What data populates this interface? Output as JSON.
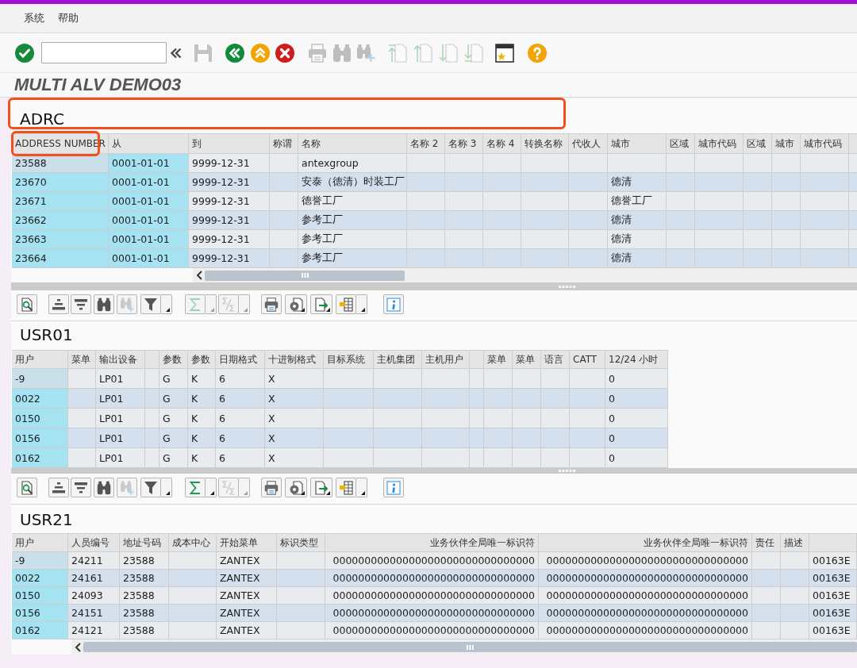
{
  "menu": [
    "系统",
    "帮助"
  ],
  "toolbar": [
    {
      "kind": "enter",
      "disabled": false
    },
    {
      "kind": "command-field"
    },
    {
      "kind": "collapse",
      "disabled": false
    },
    {
      "kind": "save",
      "disabled": true
    },
    {
      "kind": "back",
      "disabled": false
    },
    {
      "kind": "exit",
      "disabled": false
    },
    {
      "kind": "cancel",
      "disabled": false
    },
    {
      "kind": "print",
      "disabled": true
    },
    {
      "kind": "find",
      "disabled": true
    },
    {
      "kind": "find-next",
      "disabled": true
    },
    {
      "kind": "first-page",
      "disabled": true
    },
    {
      "kind": "previous-page",
      "disabled": true
    },
    {
      "kind": "next-page",
      "disabled": true
    },
    {
      "kind": "last-page",
      "disabled": true
    },
    {
      "kind": "new-session",
      "disabled": false
    },
    {
      "kind": "help",
      "disabled": false
    }
  ],
  "title": "MULTI ALV DEMO03",
  "grids": [
    {
      "title": "ADRC",
      "title_highlighted": true,
      "columns": [
        {
          "label": "ADDRESS NUMBER",
          "key": true,
          "highlighted": true
        },
        {
          "label": "从",
          "key": true,
          "highlighted": false
        },
        {
          "label": "到",
          "key": false,
          "highlighted": false
        },
        {
          "label": "称谓",
          "key": false,
          "highlighted": false
        },
        {
          "label": "名称",
          "key": false,
          "highlighted": false
        },
        {
          "label": "名称 2",
          "key": false,
          "highlighted": false
        },
        {
          "label": "名称 3",
          "key": false,
          "highlighted": false
        },
        {
          "label": "名称 4",
          "key": false,
          "highlighted": false
        },
        {
          "label": "转换名称",
          "key": false,
          "highlighted": false
        },
        {
          "label": "代收人",
          "key": false,
          "highlighted": false
        },
        {
          "label": "城市",
          "key": false,
          "highlighted": false
        },
        {
          "label": "区域",
          "key": false,
          "highlighted": false
        },
        {
          "label": "城市代码",
          "key": false,
          "highlighted": false
        },
        {
          "label": "区域",
          "key": false,
          "highlighted": false
        },
        {
          "label": "城市",
          "key": false,
          "highlighted": false
        },
        {
          "label": "城市代码",
          "key": false,
          "highlighted": false
        }
      ],
      "rows": [
        {
          "focused": true,
          "cells": [
            "23588",
            "0001-01-01",
            "9999-12-31",
            null,
            "antexgroup",
            null,
            null,
            null,
            null,
            null,
            null,
            null,
            null,
            null,
            null,
            null
          ]
        },
        {
          "focused": false,
          "cells": [
            "23670",
            "0001-01-01",
            "9999-12-31",
            null,
            "安泰（德清）时装工厂",
            null,
            null,
            null,
            null,
            null,
            "德清",
            null,
            null,
            null,
            null,
            null
          ]
        },
        {
          "focused": false,
          "cells": [
            "23671",
            "0001-01-01",
            "9999-12-31",
            null,
            "德誉工厂",
            null,
            null,
            null,
            null,
            null,
            "德誉工厂",
            null,
            null,
            null,
            null,
            null
          ]
        },
        {
          "focused": false,
          "cells": [
            "23662",
            "0001-01-01",
            "9999-12-31",
            null,
            "参考工厂",
            null,
            null,
            null,
            null,
            null,
            "德清",
            null,
            null,
            null,
            null,
            null
          ]
        },
        {
          "focused": false,
          "cells": [
            "23663",
            "0001-01-01",
            "9999-12-31",
            null,
            "参考工厂",
            null,
            null,
            null,
            null,
            null,
            "德清",
            null,
            null,
            null,
            null,
            null
          ]
        },
        {
          "focused": false,
          "cells": [
            "23664",
            "0001-01-01",
            "9999-12-31",
            null,
            "参考工厂",
            null,
            null,
            null,
            null,
            null,
            "德清",
            null,
            null,
            null,
            null,
            null
          ]
        }
      ]
    },
    {
      "title": "USR01",
      "title_highlighted": false,
      "toolbar": [
        {
          "kind": "details",
          "disabled": false,
          "split_menu": false,
          "inline_menu": false
        },
        {
          "kind": "sort-asc",
          "disabled": false,
          "split_menu": false,
          "inline_menu": false
        },
        {
          "kind": "sort-desc",
          "disabled": false,
          "split_menu": false,
          "inline_menu": false
        },
        {
          "kind": "find",
          "disabled": false,
          "split_menu": false,
          "inline_menu": false
        },
        {
          "kind": "find-next",
          "disabled": true,
          "split_menu": false,
          "inline_menu": false
        },
        {
          "kind": "filter",
          "disabled": false,
          "split_menu": true,
          "inline_menu": false
        },
        {
          "kind": "sum",
          "disabled": true,
          "split_menu": true,
          "inline_menu": false
        },
        {
          "kind": "subtotal",
          "disabled": true,
          "split_menu": true,
          "inline_menu": false
        },
        {
          "kind": "print",
          "disabled": false,
          "split_menu": false,
          "inline_menu": false
        },
        {
          "kind": "views",
          "disabled": false,
          "split_menu": false,
          "inline_menu": true
        },
        {
          "kind": "export",
          "disabled": false,
          "split_menu": false,
          "inline_menu": true
        },
        {
          "kind": "layout",
          "disabled": false,
          "split_menu": true,
          "inline_menu": false
        },
        {
          "kind": "info",
          "disabled": false,
          "split_menu": false,
          "inline_menu": false
        }
      ],
      "columns": [
        {
          "label": "用户",
          "key": true,
          "highlighted": false
        },
        {
          "label": "菜单",
          "key": false,
          "highlighted": false
        },
        {
          "label": "输出设备",
          "key": false,
          "highlighted": false
        },
        {
          "key": false,
          "highlighted": false
        },
        {
          "label": "参数",
          "key": false,
          "highlighted": false
        },
        {
          "label": "参数",
          "key": false,
          "highlighted": false
        },
        {
          "label": "日期格式",
          "key": false,
          "highlighted": false
        },
        {
          "label": "十进制格式",
          "key": false,
          "highlighted": false
        },
        {
          "label": "目标系统",
          "key": false,
          "highlighted": false
        },
        {
          "label": "主机集团",
          "key": false,
          "highlighted": false
        },
        {
          "label": "主机用户",
          "key": false,
          "highlighted": false
        },
        {
          "key": false,
          "highlighted": false
        },
        {
          "label": "菜单",
          "key": false,
          "highlighted": false
        },
        {
          "label": "菜单",
          "key": false,
          "highlighted": false
        },
        {
          "label": "语言",
          "key": false,
          "highlighted": false
        },
        {
          "label": "CATT",
          "key": false,
          "highlighted": false
        },
        {
          "label": "12/24 小时",
          "key": false,
          "highlighted": false
        }
      ],
      "rows": [
        {
          "focused": true,
          "cells": [
            "-9",
            null,
            "LP01",
            null,
            "G",
            "K",
            "6",
            "X",
            null,
            null,
            null,
            null,
            null,
            null,
            null,
            null,
            "0"
          ]
        },
        {
          "focused": false,
          "cells": [
            "0022",
            null,
            "LP01",
            null,
            "G",
            "K",
            "6",
            "X",
            null,
            null,
            null,
            null,
            null,
            null,
            null,
            null,
            "0"
          ]
        },
        {
          "focused": false,
          "cells": [
            "0150",
            null,
            "LP01",
            null,
            "G",
            "K",
            "6",
            "X",
            null,
            null,
            null,
            null,
            null,
            null,
            null,
            null,
            "0"
          ]
        },
        {
          "focused": false,
          "cells": [
            "0156",
            null,
            "LP01",
            null,
            "G",
            "K",
            "6",
            "X",
            null,
            null,
            null,
            null,
            null,
            null,
            null,
            null,
            "0"
          ]
        },
        {
          "focused": false,
          "cells": [
            "0162",
            null,
            "LP01",
            null,
            "G",
            "K",
            "6",
            "X",
            null,
            null,
            null,
            null,
            null,
            null,
            null,
            null,
            "0"
          ]
        }
      ]
    },
    {
      "title": "USR21",
      "title_highlighted": false,
      "toolbar": [
        {
          "kind": "details",
          "disabled": false,
          "split_menu": false,
          "inline_menu": false
        },
        {
          "kind": "sort-asc",
          "disabled": false,
          "split_menu": false,
          "inline_menu": false
        },
        {
          "kind": "sort-desc",
          "disabled": false,
          "split_menu": false,
          "inline_menu": false
        },
        {
          "kind": "find",
          "disabled": false,
          "split_menu": false,
          "inline_menu": false
        },
        {
          "kind": "find-next",
          "disabled": true,
          "split_menu": false,
          "inline_menu": false
        },
        {
          "kind": "filter",
          "disabled": false,
          "split_menu": true,
          "inline_menu": false
        },
        {
          "kind": "sum",
          "disabled": false,
          "split_menu": true,
          "inline_menu": false
        },
        {
          "kind": "subtotal",
          "disabled": true,
          "split_menu": true,
          "inline_menu": false
        },
        {
          "kind": "print",
          "disabled": false,
          "split_menu": false,
          "inline_menu": false
        },
        {
          "kind": "views",
          "disabled": false,
          "split_menu": false,
          "inline_menu": true
        },
        {
          "kind": "export",
          "disabled": false,
          "split_menu": false,
          "inline_menu": true
        },
        {
          "kind": "layout",
          "disabled": false,
          "split_menu": true,
          "inline_menu": false
        },
        {
          "kind": "info",
          "disabled": false,
          "split_menu": false,
          "inline_menu": false
        }
      ],
      "columns": [
        {
          "label": "用户",
          "key": true,
          "highlighted": false,
          "right_aligned": false
        },
        {
          "label": "人员编号",
          "key": false,
          "highlighted": false,
          "right_aligned": false
        },
        {
          "label": "地址号码",
          "key": false,
          "highlighted": false,
          "right_aligned": false
        },
        {
          "label": "成本中心",
          "key": false,
          "highlighted": false,
          "right_aligned": false
        },
        {
          "label": "开始菜单",
          "key": false,
          "highlighted": false,
          "right_aligned": false
        },
        {
          "label": "标识类型",
          "key": false,
          "highlighted": false,
          "right_aligned": false
        },
        {
          "label": "业务伙伴全局唯一标识符",
          "key": false,
          "highlighted": false,
          "right_aligned": true
        },
        {
          "label": "业务伙伴全局唯一标识符",
          "key": false,
          "highlighted": false,
          "right_aligned": true
        },
        {
          "label": "责任",
          "key": false,
          "highlighted": false,
          "right_aligned": false
        },
        {
          "label": "描述",
          "key": false,
          "highlighted": false,
          "right_aligned": false
        },
        {
          "key": false,
          "highlighted": false
        }
      ],
      "rows": [
        {
          "focused": true,
          "cells": [
            "-9",
            "24211",
            "23588",
            null,
            "ZANTEX",
            null,
            "00000000000000000000000000000000",
            "00000000000000000000000000000000",
            null,
            null,
            "00163E"
          ]
        },
        {
          "focused": false,
          "cells": [
            "0022",
            "24161",
            "23588",
            null,
            "ZANTEX",
            null,
            "00000000000000000000000000000000",
            "00000000000000000000000000000000",
            null,
            null,
            "00163E"
          ]
        },
        {
          "focused": false,
          "cells": [
            "0150",
            "24093",
            "23588",
            null,
            "ZANTEX",
            null,
            "00000000000000000000000000000000",
            "00000000000000000000000000000000",
            null,
            null,
            "00163E"
          ]
        },
        {
          "focused": false,
          "cells": [
            "0156",
            "24151",
            "23588",
            null,
            "ZANTEX",
            null,
            "00000000000000000000000000000000",
            "00000000000000000000000000000000",
            null,
            null,
            "00163E"
          ]
        },
        {
          "focused": false,
          "cells": [
            "0162",
            "24121",
            "23588",
            null,
            "ZANTEX",
            null,
            "00000000000000000000000000000000",
            "00000000000000000000000000000000",
            null,
            null,
            "00163E"
          ]
        }
      ]
    }
  ]
}
